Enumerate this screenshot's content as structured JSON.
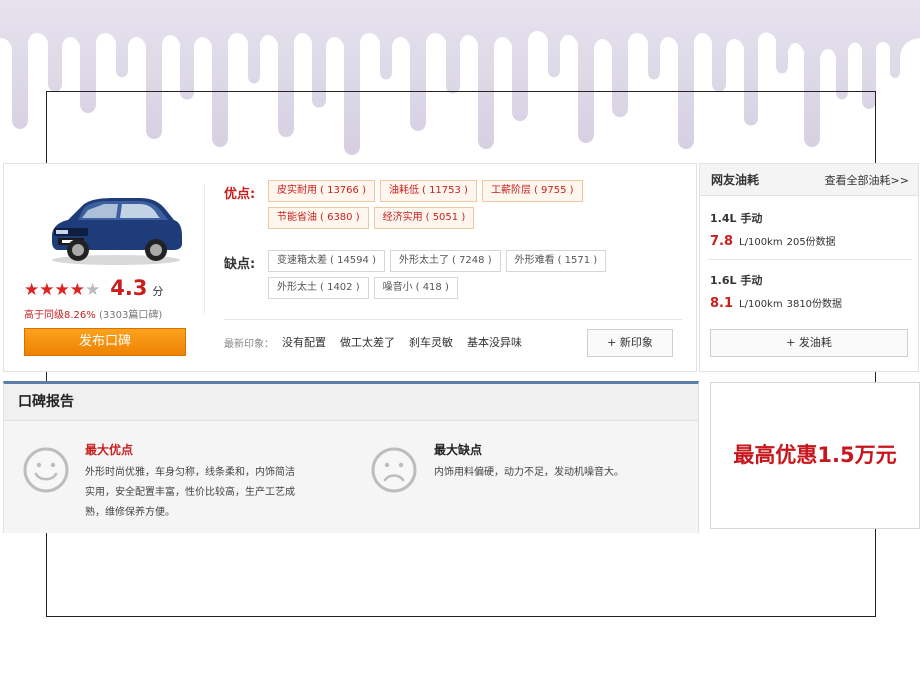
{
  "product": {
    "rating_stars": "★★★★★",
    "score": "4.3",
    "score_unit": "分",
    "compare_prefix": "高于同级",
    "compare_pct": "8.26%",
    "review_count": "(3303篇口碑)",
    "publish_button": "发布口碑"
  },
  "pros": {
    "label": "优点:",
    "tags": [
      {
        "text": "皮实耐用",
        "count": "( 13766 )"
      },
      {
        "text": "油耗低",
        "count": "( 11753 )"
      },
      {
        "text": "工薪阶层",
        "count": "( 9755 )"
      },
      {
        "text": "节能省油",
        "count": "( 6380 )"
      },
      {
        "text": "经济实用",
        "count": "( 5051 )"
      }
    ]
  },
  "cons": {
    "label": "缺点:",
    "tags": [
      {
        "text": "变速箱太差",
        "count": "( 14594 )"
      },
      {
        "text": "外形太土了",
        "count": "( 7248 )"
      },
      {
        "text": "外形难看",
        "count": "( 1571 )"
      },
      {
        "text": "外形太土",
        "count": "( 1402 )"
      },
      {
        "text": "噪音小",
        "count": "( 418 )"
      }
    ]
  },
  "impressions": {
    "label": "最新印象：",
    "items": [
      "没有配置",
      "做工太差了",
      "刹车灵敏",
      "基本没异味"
    ],
    "new_button": "+ 新印象"
  },
  "fuel": {
    "title": "网友油耗",
    "view_all": "查看全部油耗>>",
    "rows": [
      {
        "spec": "1.4L 手动",
        "value": "7.8",
        "unit": "L/100km",
        "data": "205份数据"
      },
      {
        "spec": "1.6L 手动",
        "value": "8.1",
        "unit": "L/100km",
        "data": "3810份数据"
      }
    ],
    "button": "+ 发油耗"
  },
  "report": {
    "title": "口碑报告",
    "best": {
      "title": "最大优点",
      "lines": [
        "外形时尚优雅，车身匀称，线条柔和，内饰简洁",
        "实用，安全配置丰富，性价比较高，生产工艺成",
        "熟，维修保养方便。"
      ]
    },
    "worst": {
      "title": "最大缺点",
      "lines": [
        "内饰用料偏硬，动力不足，发动机噪音大。"
      ]
    }
  },
  "ad": {
    "text": "最高优惠1.5万元"
  },
  "colors": {
    "accent_red": "#c81f1f",
    "orange_button": "#f39211",
    "report_top_border": "#5b7fa8",
    "drip": "#dcd6e6"
  }
}
